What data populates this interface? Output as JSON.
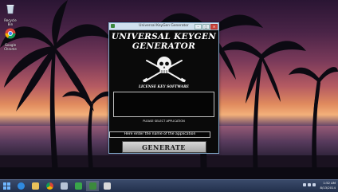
{
  "desktop": {
    "icons": [
      {
        "label": "Recycle Bin",
        "icon": "recycle-bin-icon"
      },
      {
        "label": "Google Chrome",
        "icon": "chrome-icon"
      }
    ]
  },
  "window": {
    "title": "Universal KeyGen Generator",
    "heading_line1": "UNIVERSAL KEYGEN",
    "heading_line2": "GENERATOR",
    "tagline": "LICENSE KEY SOFTWARE",
    "prompt": "PLEASE SELECT APPLICATION",
    "input_value": "Here enter the name of the application",
    "generate_label": "GENERATE",
    "buttons": [
      "–",
      "□",
      "✕"
    ]
  },
  "taskbar": {
    "apps": [
      "start",
      "internet-explorer",
      "file-explorer",
      "chrome",
      "media-player",
      "store",
      "keygen-app",
      "misc-app"
    ],
    "time": "1:52 AM",
    "date": "8/13/2014"
  },
  "colors": {
    "window_bg": "#0a0a0a",
    "titlebar": "#cfe0ee",
    "taskbar": "#22304c"
  }
}
